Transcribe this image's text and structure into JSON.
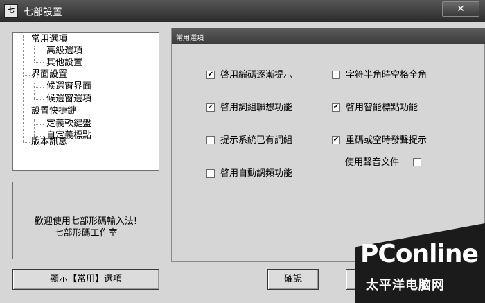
{
  "window": {
    "title": "七部設置",
    "icon_name": "app-icon",
    "icon_text": "七",
    "close_symbol": "✕"
  },
  "tree": {
    "items": [
      {
        "label": "常用選項",
        "level": 0
      },
      {
        "label": "高級選項",
        "level": 1
      },
      {
        "label": "其他設置",
        "level": 1
      },
      {
        "label": "界面設置",
        "level": 0
      },
      {
        "label": "候選窗界面",
        "level": 1
      },
      {
        "label": "候選窗選項",
        "level": 1
      },
      {
        "label": "設置快捷鍵",
        "level": 0
      },
      {
        "label": "定義軟鍵盤",
        "level": 1
      },
      {
        "label": "自定義標點",
        "level": 1
      },
      {
        "label": "版本訊息",
        "level": 0
      }
    ]
  },
  "welcome": {
    "line1": "歡迎使用七部形碼輸入法!",
    "line2": "七部形碼工作室"
  },
  "options": {
    "header": "常用選項",
    "items": [
      {
        "label": "啓用編碼逐漸提示",
        "checked": true
      },
      {
        "label": "字符半角時空格全角",
        "checked": false
      },
      {
        "label": "啓用詞組聯想功能",
        "checked": true
      },
      {
        "label": "啓用智能標點功能",
        "checked": true
      },
      {
        "label": "提示系統已有詞組",
        "checked": false
      },
      {
        "label": "重碼或空時發聲提示",
        "checked": true
      },
      {
        "label": "使用聲音文件",
        "checked": false
      },
      {
        "label": "啓用自動調頻功能",
        "checked": false
      }
    ],
    "check_mark": "✔"
  },
  "buttons": {
    "show_label": "顯示【常用】選項",
    "confirm_label": "確認"
  },
  "watermark": {
    "logo": "PConline",
    "sub": "太平洋电脑网"
  }
}
